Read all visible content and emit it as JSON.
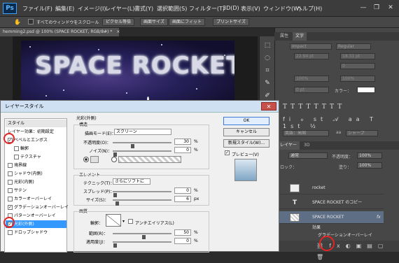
{
  "app": {
    "logo": "Ps"
  },
  "menu": [
    "ファイル(F)",
    "編集(E)",
    "イメージ(I)",
    "レイヤー(L)",
    "書式(Y)",
    "選択範囲(S)",
    "フィルター(T)",
    "3D(D)",
    "表示(V)",
    "ウィンドウ(W)",
    "ヘルプ(H)"
  ],
  "window_controls": {
    "minimize": "—",
    "restore": "❐",
    "close": "✕"
  },
  "options_bar": {
    "scroll_all_label": "すべてのウィンドウをスクロール",
    "btn_pixel": "ピクセル等倍",
    "btn_screen": "画面サイズ",
    "btn_fit": "画面にフィット",
    "btn_print": "プリントサイズ"
  },
  "document": {
    "tab_title": "hemming2.psd @ 100% (SPACE ROCKET, RGB/8#) *",
    "tab_close": "×"
  },
  "canvas": {
    "headline": "SPACE ROCKET"
  },
  "right_panel": {
    "tabs": [
      "属性",
      "文字"
    ],
    "font_family": "Impact",
    "font_style": "Regular",
    "size1": "22.94 pt",
    "size2": "18.31 pt",
    "tracking": "0",
    "scale_v": "100%",
    "scale_h": "100%",
    "baseline": "0 pt",
    "color_label": "カラー：",
    "language": "英語：米国",
    "aa": "aa",
    "aa_value": "シャープ",
    "layers_tabs": [
      "レイヤー",
      "3D"
    ],
    "blend": "通常",
    "opacity_label": "不透明度：",
    "opacity": "100%",
    "lock_label": "ロック：",
    "fill_label": "塗り：",
    "fill": "100%",
    "layers": [
      {
        "name": "rocket"
      },
      {
        "name": "SPACE ROCKET のコピー"
      },
      {
        "name": "SPACE ROCKET",
        "fx": "fx"
      },
      {
        "name": "効果"
      },
      {
        "name": "グラデーションオーバーレイ"
      }
    ]
  },
  "dialog": {
    "title": "レイヤースタイル",
    "close": "✕",
    "styles_header": "スタイル",
    "styles": [
      {
        "label": "レイヤー効果：初期設定",
        "checkbox": false
      },
      {
        "label": "ベベルとエンボス",
        "checkbox": true,
        "checked": true
      },
      {
        "label": "輪郭",
        "checkbox": true,
        "checked": false,
        "indent": true
      },
      {
        "label": "テクスチャ",
        "checkbox": true,
        "checked": false,
        "indent": true
      },
      {
        "label": "境界線",
        "checkbox": true,
        "checked": false
      },
      {
        "label": "シャドウ(内側)",
        "checkbox": true,
        "checked": false
      },
      {
        "label": "光彩(内側)",
        "checkbox": true,
        "checked": false
      },
      {
        "label": "サテン",
        "checkbox": true,
        "checked": false
      },
      {
        "label": "カラーオーバーレイ",
        "checkbox": true,
        "checked": false
      },
      {
        "label": "グラデーションオーバーレイ",
        "checkbox": true,
        "checked": true
      },
      {
        "label": "パターンオーバーレイ",
        "checkbox": true,
        "checked": false
      },
      {
        "label": "光彩(外側)",
        "checkbox": true,
        "checked": true,
        "selected": true
      },
      {
        "label": "ドロップシャドウ",
        "checkbox": true,
        "checked": false
      }
    ],
    "outer_glow": {
      "section_title": "光彩(外側)",
      "structure_title": "構造",
      "blend_mode_label": "描画モード(E)：",
      "blend_mode": "スクリーン",
      "opacity_label": "不透明度(O)：",
      "opacity": "30",
      "opacity_fraction": 0.3,
      "noise_label": "ノイズ(N)：",
      "noise": "0",
      "noise_fraction": 0.0,
      "percent": "%",
      "elements_title": "エレメント",
      "technique_label": "テクニック(T)：",
      "technique": "さらにソフトに",
      "spread_label": "スプレッド(P)：",
      "spread": "0",
      "spread_fraction": 0.0,
      "size_label": "サイズ(S)：",
      "size": "6",
      "size_fraction": 0.04,
      "px": "px",
      "quality_title": "画質",
      "contour_label": "輪郭：",
      "antialias_label": "アンチエイリアス(L)",
      "range_label": "範囲(R)：",
      "range": "50",
      "range_fraction": 0.5,
      "jitter_label": "適用度(J)：",
      "jitter": "0",
      "jitter_fraction": 0.0
    },
    "buttons": {
      "ok": "OK",
      "cancel": "キャンセル",
      "new_style": "新規スタイル(W)...",
      "preview": "プレビュー(V)"
    }
  }
}
